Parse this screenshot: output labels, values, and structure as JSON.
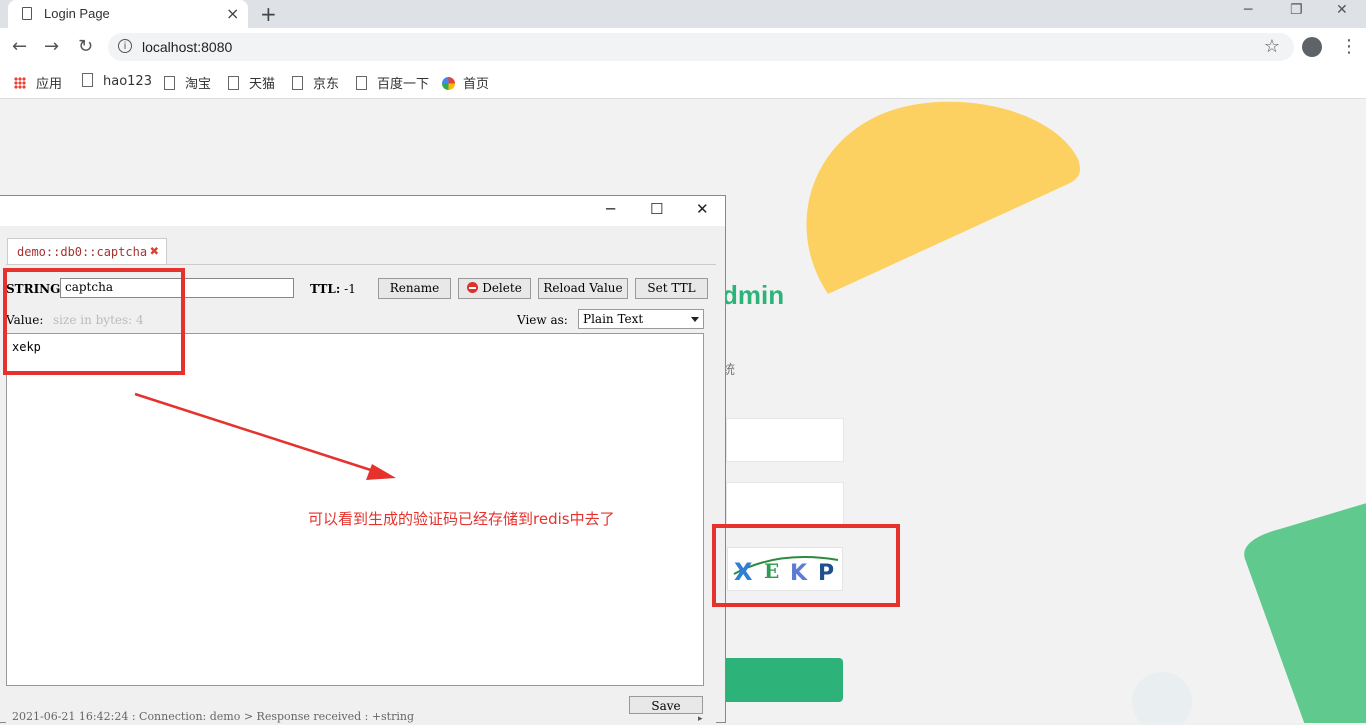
{
  "browser": {
    "tab_title": "Login Page",
    "tab_close": "×",
    "new_tab": "+",
    "url": "localhost:8080",
    "window_controls": [
      "─",
      "❐",
      "✕"
    ],
    "bookmarks": [
      "应用",
      "hao123",
      "淘宝",
      "天猫",
      "京东",
      "百度一下",
      "首页"
    ]
  },
  "page": {
    "brand_title_fragment": "dmin",
    "subtitle_fragment": "统",
    "captcha_letters": [
      "X",
      "E",
      "K",
      "P"
    ],
    "colors": {
      "brand_green": "#2db37a",
      "blob_yellow": "#fdd161",
      "blob_green": "#5fc98e"
    }
  },
  "redis_window": {
    "controls": [
      "─",
      "☐",
      "✕"
    ],
    "tab_label": "demo::db0::captcha",
    "key_type_label": "STRING:",
    "key_name": "captcha",
    "ttl_label": "TTL:",
    "ttl_value": "-1",
    "buttons": {
      "rename": "Rename",
      "delete": "Delete",
      "reload": "Reload Value",
      "set_ttl": "Set TTL",
      "save": "Save"
    },
    "value_label": "Value:",
    "value_size": "size in bytes: 4",
    "view_as_label": "View as:",
    "view_as_value": "Plain Text",
    "value_text": "xekp",
    "log_line": "2021-06-21 16:42:24 : Connection: demo > Response received : +string"
  },
  "annotation": {
    "text": "可以看到生成的验证码已经存储到redis中去了",
    "color": "#e5322d"
  }
}
